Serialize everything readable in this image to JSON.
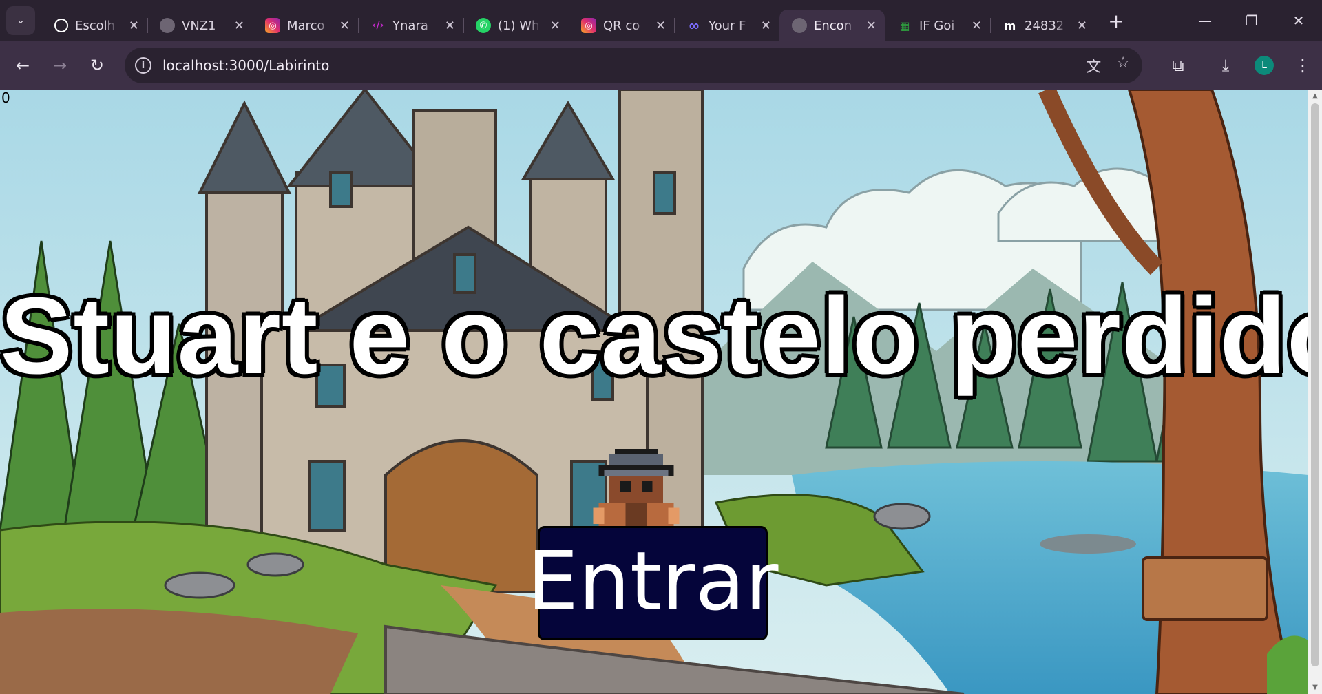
{
  "browser": {
    "tabs": [
      {
        "label": "Escolh",
        "icon": "openai-icon",
        "color": "#ffffff"
      },
      {
        "label": "VNZ1",
        "icon": "globe-icon",
        "color": "#b9b2bf"
      },
      {
        "label": "Marco",
        "icon": "instagram-icon",
        "color": "#e1306c"
      },
      {
        "label": "Ynara",
        "icon": "code-icon",
        "color": "#c02ac8"
      },
      {
        "label": "(1) Wh",
        "icon": "whatsapp-icon",
        "color": "#25d366"
      },
      {
        "label": "QR co",
        "icon": "instagram-icon",
        "color": "#e1306c"
      },
      {
        "label": "Your F",
        "icon": "infinity-icon",
        "color": "#7b6cff"
      },
      {
        "label": "Encon",
        "icon": "globe-icon",
        "color": "#b9b2bf",
        "active": true
      },
      {
        "label": "IF Goi",
        "icon": "grid-icon",
        "color": "#2e9b3e"
      },
      {
        "label": "24832",
        "icon": "m-logo-icon",
        "color": "#ffffff"
      }
    ],
    "url": "localhost:3000/Labirinto",
    "profile_initial": "L"
  },
  "page": {
    "counter": "0",
    "title": "Stuart e o castelo perdido!",
    "enter_label": "Entrar"
  }
}
